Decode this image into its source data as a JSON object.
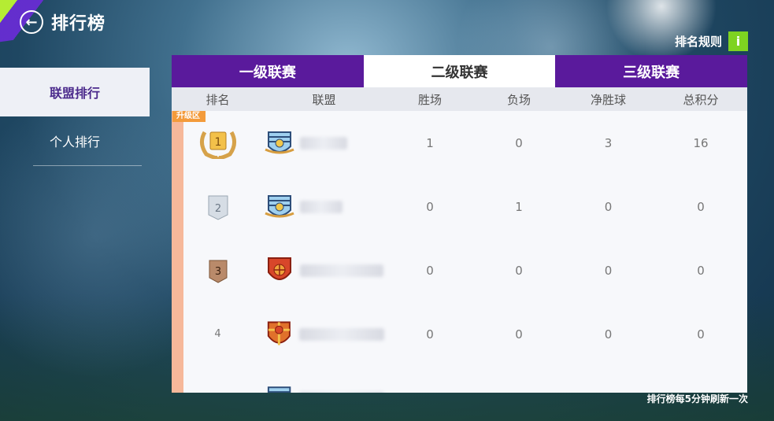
{
  "header": {
    "title": "排行榜"
  },
  "rules": {
    "label": "排名规则",
    "icon": "i"
  },
  "sidebar": {
    "items": [
      {
        "label": "联盟排行",
        "active": true
      },
      {
        "label": "个人排行",
        "active": false
      }
    ]
  },
  "tabs": [
    {
      "label": "一级联赛",
      "selected": false
    },
    {
      "label": "二级联赛",
      "selected": true
    },
    {
      "label": "三级联赛",
      "selected": false
    }
  ],
  "table": {
    "headers": [
      "排名",
      "联盟",
      "胜场",
      "负场",
      "净胜球",
      "总积分"
    ],
    "promotion_tag": "升级区",
    "rows": [
      {
        "rank": "1",
        "wins": "1",
        "losses": "0",
        "goal_diff": "3",
        "points": "16"
      },
      {
        "rank": "2",
        "wins": "0",
        "losses": "1",
        "goal_diff": "0",
        "points": "0"
      },
      {
        "rank": "3",
        "wins": "0",
        "losses": "0",
        "goal_diff": "0",
        "points": "0"
      },
      {
        "rank": "4",
        "wins": "0",
        "losses": "0",
        "goal_diff": "0",
        "points": "0"
      },
      {
        "rank": "",
        "wins": "",
        "losses": "",
        "goal_diff": "",
        "points": ""
      }
    ]
  },
  "footer": {
    "note": "排行榜每5分钟刷新一次"
  },
  "colors": {
    "tab_purple": "#5a1a9c",
    "accent_green": "#7ed321",
    "promo_orange": "#f39b3b"
  }
}
